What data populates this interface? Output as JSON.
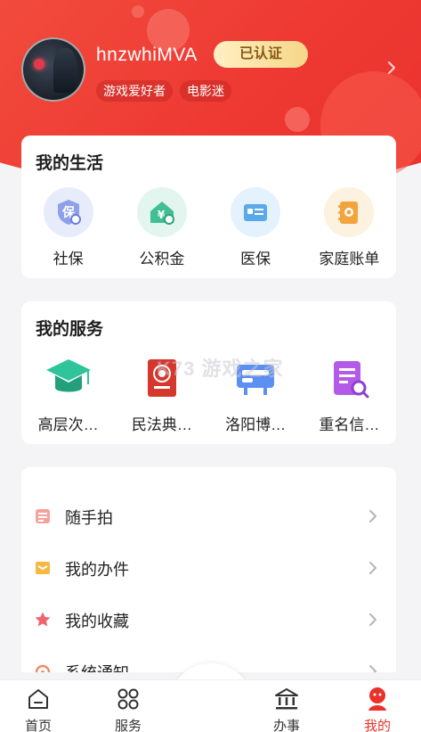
{
  "profile": {
    "username": "hnzwhiMVA",
    "verified_label": "已认证",
    "tags": [
      "游戏爱好者",
      "电影迷"
    ]
  },
  "life": {
    "title": "我的生活",
    "items": [
      {
        "label": "社保",
        "icon": "social-security-icon",
        "glyph": "保"
      },
      {
        "label": "公积金",
        "icon": "housing-fund-icon",
        "glyph": "¥"
      },
      {
        "label": "医保",
        "icon": "medical-insurance-icon"
      },
      {
        "label": "家庭账单",
        "icon": "family-bill-icon"
      }
    ]
  },
  "services": {
    "title": "我的服务",
    "items": [
      {
        "label": "高层次…",
        "icon": "graduation-cap-icon"
      },
      {
        "label": "民法典…",
        "icon": "civil-code-book-icon"
      },
      {
        "label": "洛阳博…",
        "icon": "museum-ticket-icon"
      },
      {
        "label": "重名信…",
        "icon": "name-search-icon"
      }
    ]
  },
  "list": [
    {
      "label": "随手拍",
      "icon": "snapshot-icon"
    },
    {
      "label": "我的办件",
      "icon": "my-cases-icon"
    },
    {
      "label": "我的收藏",
      "icon": "star-icon"
    },
    {
      "label": "系统通知",
      "icon": "notification-icon"
    }
  ],
  "tabs": [
    {
      "label": "首页",
      "icon": "home-icon"
    },
    {
      "label": "服务",
      "icon": "grid-icon"
    },
    {
      "label": "办事",
      "icon": "government-building-icon"
    },
    {
      "label": "我的",
      "icon": "profile-icon",
      "active": true
    }
  ],
  "watermark": "K73 游戏之家",
  "colors": {
    "brand_red": "#e8322b",
    "verified_gold": "#f6d688"
  }
}
